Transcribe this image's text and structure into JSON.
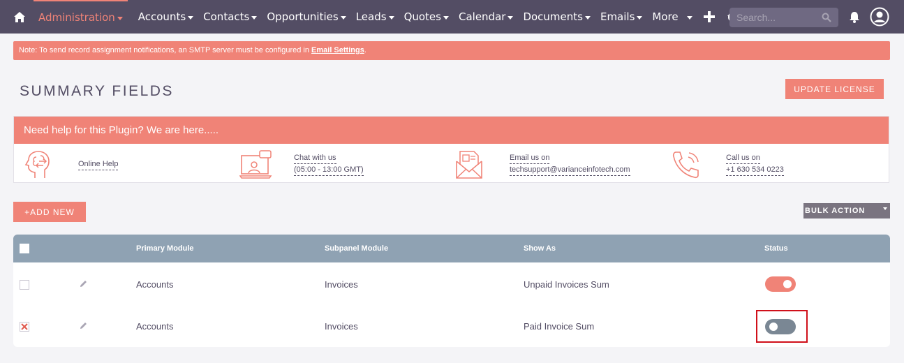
{
  "nav": {
    "items": [
      {
        "label": "Administration",
        "active": true
      },
      {
        "label": "Accounts"
      },
      {
        "label": "Contacts"
      },
      {
        "label": "Opportunities"
      },
      {
        "label": "Leads"
      },
      {
        "label": "Quotes"
      },
      {
        "label": "Calendar"
      },
      {
        "label": "Documents"
      },
      {
        "label": "Emails"
      },
      {
        "label": "More"
      }
    ],
    "search_placeholder": "Search...",
    "icons": [
      "home-icon",
      "plus-icon",
      "history-icon",
      "search-icon",
      "bell-icon",
      "user-icon"
    ]
  },
  "alert": {
    "text": "Note: To send record assignment notifications, an SMTP server must be configured in ",
    "link": "Email Settings",
    "suffix": "."
  },
  "page": {
    "title": "SUMMARY FIELDS",
    "update_license": "UPDATE LICENSE"
  },
  "help": {
    "header": "Need help for this Plugin? We are here.....",
    "online": "Online Help",
    "chat_line1": "Chat with us",
    "chat_line2": "(05:00 - 13:00 GMT)",
    "email_line1": "Email us on",
    "email_line2": "techsupport@varianceinfotech.com",
    "call_line1": "Call us on",
    "call_line2": "+1 630 534 0223"
  },
  "actions": {
    "add_new": "+ADD NEW",
    "bulk_action": "BULK ACTION"
  },
  "table": {
    "columns": [
      "Primary Module",
      "Subpanel Module",
      "Show As",
      "Status"
    ],
    "rows": [
      {
        "primary": "Accounts",
        "subpanel": "Invoices",
        "show_as": "Unpaid Invoices Sum",
        "status": "on"
      },
      {
        "primary": "Accounts",
        "subpanel": "Invoices",
        "show_as": "Paid Invoice Sum",
        "status": "off"
      }
    ]
  },
  "colors": {
    "nav_bg": "#534d64",
    "accent": "#f08377",
    "table_header": "#8fa2b3",
    "toggle_off": "#7a8794",
    "highlight": "#d0101a"
  }
}
